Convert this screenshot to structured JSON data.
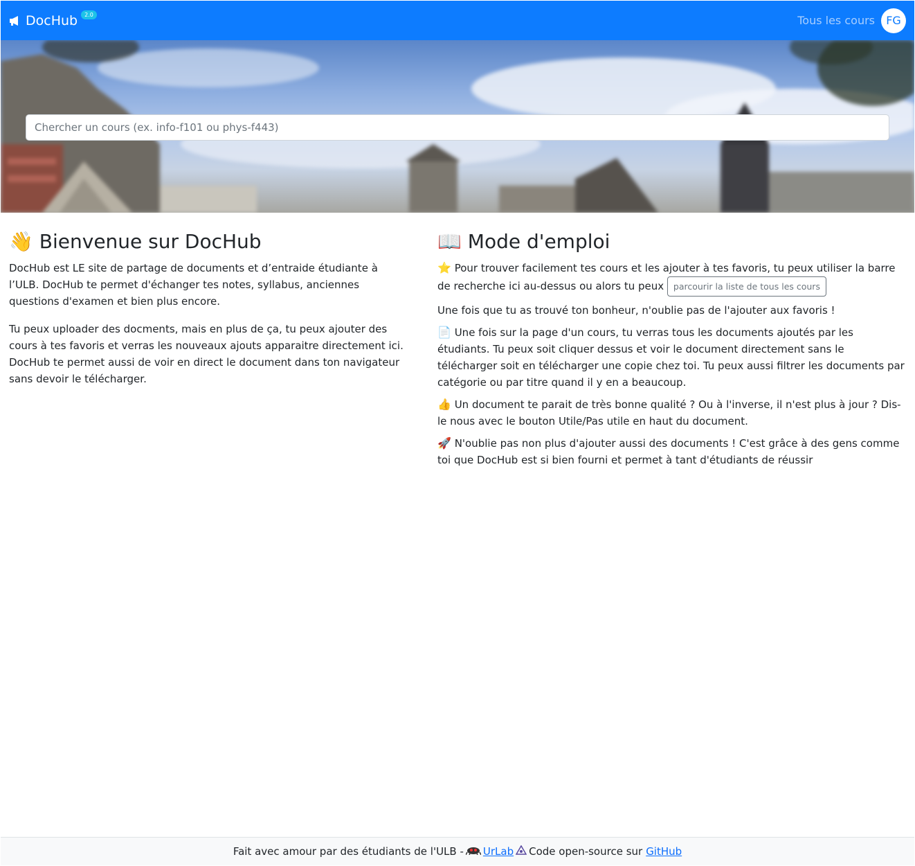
{
  "navbar": {
    "brand": "DocHub",
    "version": "2.0",
    "courses_link": "Tous les cours",
    "avatar_initials": "FG",
    "color": "#0d7cff"
  },
  "search": {
    "placeholder": "Chercher un cours (ex. info-f101 ou phys-f443)",
    "value": ""
  },
  "welcome": {
    "emoji": "👋",
    "title": "Bienvenue sur DocHub",
    "paragraphs": [
      "DocHub est LE site de partage de documents et d’entraide étudiante à l’ULB. DocHub te permet d'échanger tes notes, syllabus, anciennes questions d'examen et bien plus encore.",
      "Tu peux uploader des docments, mais en plus de ça, tu peux ajouter des cours à tes favoris et verras les nouveaux ajouts apparaitre directement ici. DocHub te permet aussi de voir en direct le document dans ton navigateur sans devoir le télécharger."
    ]
  },
  "guide": {
    "emoji": "📖",
    "title": "Mode d'emploi",
    "p1_emoji": "⭐",
    "p1_text": "Pour trouver facilement tes cours et les ajouter à tes favoris, tu peux utiliser la barre de recherche ici au-dessus ou alors tu peux",
    "p1_button": "parcourir la liste de tous les cours",
    "p2_text": "Une fois que tu as trouvé ton bonheur, n'oublie pas de l'ajouter aux favoris !",
    "p3_emoji": "📄",
    "p3_text": "Une fois sur la page d'un cours, tu verras tous les documents ajoutés par les étudiants. Tu peux soit cliquer dessus et voir le document directement sans le télécharger soit en télécharger une copie chez toi. Tu peux aussi filtrer les documents par catégorie ou par titre quand il y en a beaucoup.",
    "p4_emoji": "👍",
    "p4_text": "Un document te parait de très bonne qualité ? Ou à l'inverse, il n'est plus à jour ? Dis-le nous avec le bouton Utile/Pas utile en haut du document.",
    "p5_emoji": "🚀",
    "p5_text": "N'oublie pas non plus d'ajouter aussi des documents ! C'est grâce à des gens comme toi que DocHub est si bien fourni et permet à tant d'étudiants de réussir"
  },
  "footer": {
    "text_before": "Fait avec amour par des étudiants de l'ULB -",
    "urlab_link": "UrLab",
    "text_middle": "Code open-source sur",
    "github_link": "GitHub"
  }
}
